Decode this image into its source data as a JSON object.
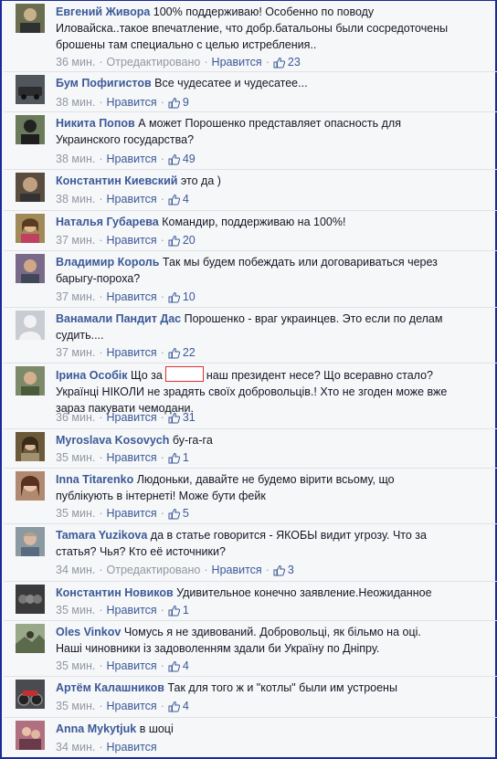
{
  "comments": [
    {
      "author": "Евгений Живора",
      "lines": [
        "100% поддерживаю! Особенно по поводу",
        "Иловайска..такое впечатление, что добр.батальоны были сосредоточены",
        "брошены там специально с целью истребления.."
      ],
      "time": "36 мин.",
      "edited": "Отредактировано",
      "like": "Нравится",
      "count": "23",
      "avatar_color": "#6b6d50"
    },
    {
      "author": "Бум Пофигистов",
      "lines": [
        "Все чудесатее и чудесатее..."
      ],
      "time": "38 мин.",
      "like": "Нравится",
      "count": "9",
      "avatar_color": "#50565c"
    },
    {
      "author": "Никита Попов",
      "lines": [
        "А может Порошенко представляет опасность для",
        "Украинского государства?"
      ],
      "time": "38 мин.",
      "like": "Нравится",
      "count": "49",
      "avatar_color": "#6a7a5a"
    },
    {
      "author": "Константин Киевский",
      "lines": [
        "это да )"
      ],
      "time": "38 мин.",
      "like": "Нравится",
      "count": "4",
      "avatar_color": "#5a4d40"
    },
    {
      "author": "Наталья Губарева",
      "lines": [
        "Командир, поддерживаю на 100%!"
      ],
      "time": "37 мин.",
      "like": "Нравится",
      "count": "20",
      "avatar_color": "#a08a5a"
    },
    {
      "author": "Владимир Король",
      "lines": [
        "Так мы будем побеждать или договариваться через",
        "барыгу-пороха?"
      ],
      "time": "37 мин.",
      "like": "Нравится",
      "count": "10",
      "avatar_color": "#7a6a8a"
    },
    {
      "author": "Ванамали Пандит Дас",
      "lines": [
        "Порошенко - враг украинцев. Это если по делам",
        "судить...."
      ],
      "time": "37 мин.",
      "like": "Нравится",
      "count": "22",
      "avatar_color": "#c9ccd2"
    },
    {
      "author": "Ірина Особік",
      "line1_before": "Що за",
      "line1_after": "наш президент несе? Що всеравно стало?",
      "lines": [
        "Українці НІКОЛИ не зрадять своїх добровольців.! Хто не згоден може вже",
        "зараз пакувати чемодани."
      ],
      "time": "36 мин.",
      "like": "Нравится",
      "count": "31",
      "avatar_color": "#7d8a6a"
    },
    {
      "author": "Myroslava Kosovych",
      "lines": [
        "бу-га-га"
      ],
      "time": "35 мин.",
      "like": "Нравится",
      "count": "1",
      "avatar_color": "#6a5a3a"
    },
    {
      "author": "Inna Titarenko",
      "lines": [
        "Людоньки, давайте не будемо вірити всьому, що",
        "публікують в інтернеті! Може бути фейк"
      ],
      "time": "35 мин.",
      "like": "Нравится",
      "count": "5",
      "avatar_color": "#b08a70"
    },
    {
      "author": "Tamara Yuzikova",
      "lines": [
        "да в статье говорится - ЯКОБЫ видит угрозу. Что за",
        "статья? Чья? Кто её источники?"
      ],
      "time": "34 мин.",
      "edited": "Отредактировано",
      "like": "Нравится",
      "count": "3",
      "avatar_color": "#8a9aa0"
    },
    {
      "author": "Константин Новиков",
      "lines": [
        "Удивительное конечно заявление.Неожиданное"
      ],
      "time": "35 мин.",
      "like": "Нравится",
      "count": "1",
      "avatar_color": "#3a3a3a"
    },
    {
      "author": "Oles Vinkov",
      "lines": [
        "Чомусь я не здивований. Добровольці, як більмо на оці.",
        "Наші чиновники із задоволенням здали би Україну по Дніпру."
      ],
      "time": "35 мин.",
      "like": "Нравится",
      "count": "4",
      "avatar_color": "#5a6a4a"
    },
    {
      "author": "Артём Калашников",
      "lines": [
        "Так для того ж и \"котлы\" были им устроены"
      ],
      "time": "35 мин.",
      "like": "Нравится",
      "count": "4",
      "avatar_color": "#4a4a50"
    },
    {
      "author": "Anna Mykytjuk",
      "lines": [
        "в шоці"
      ],
      "time": "34 мин.",
      "like": "Нравится",
      "avatar_color": "#b07080"
    }
  ]
}
